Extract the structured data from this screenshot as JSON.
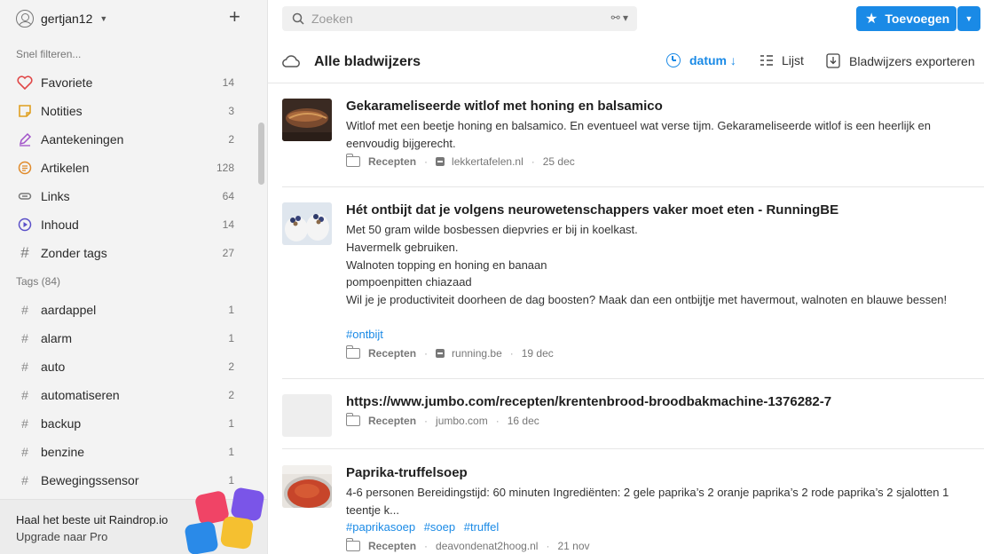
{
  "user": {
    "name": "gertjan12"
  },
  "sidebar": {
    "quick_filter": "Snel filteren...",
    "filters": [
      {
        "label": "Favoriete",
        "count": "14",
        "icon": "heart-icon"
      },
      {
        "label": "Notities",
        "count": "3",
        "icon": "note-icon"
      },
      {
        "label": "Aantekeningen",
        "count": "2",
        "icon": "pencil-icon"
      },
      {
        "label": "Artikelen",
        "count": "128",
        "icon": "article-icon"
      },
      {
        "label": "Links",
        "count": "64",
        "icon": "link-icon"
      },
      {
        "label": "Inhoud",
        "count": "14",
        "icon": "play-icon"
      },
      {
        "label": "Zonder tags",
        "count": "27",
        "icon": "hash-icon"
      }
    ],
    "tags_title": "Tags (84)",
    "tags": [
      {
        "label": "aardappel",
        "count": "1"
      },
      {
        "label": "alarm",
        "count": "1"
      },
      {
        "label": "auto",
        "count": "2"
      },
      {
        "label": "automatiseren",
        "count": "2"
      },
      {
        "label": "backup",
        "count": "1"
      },
      {
        "label": "benzine",
        "count": "1"
      },
      {
        "label": "Bewegingssensor",
        "count": "1"
      }
    ],
    "promo": {
      "title": "Haal het beste uit Raindrop.io",
      "subtitle": "Upgrade naar Pro"
    }
  },
  "header": {
    "search_placeholder": "Zoeken",
    "add_label": "Toevoegen",
    "page_title": "Alle bladwijzers",
    "sort_label": "datum ↓",
    "view_label": "Lijst",
    "export_label": "Bladwijzers exporteren"
  },
  "bookmarks": [
    {
      "title": "Gekarameliseerde witlof met honing en balsamico",
      "desc": [
        "Witlof met een beetje honing en balsamico. En eventueel wat verse tijm. Gekarameliseerde witlof is een heerlijk en eenvoudig bijgerecht."
      ],
      "tags": [],
      "collection": "Recepten",
      "domain": "lekkertafelen.nl",
      "date": "25 dec"
    },
    {
      "title": "Hét ontbijt dat je volgens neurowetenschappers vaker moet eten - RunningBE",
      "desc": [
        "Met 50 gram wilde bosbessen diepvries er bij in koelkast.",
        "Havermelk gebruiken.",
        "Walnoten topping en honing en banaan",
        "pompoenpitten chiazaad",
        "Wil je je productiviteit doorheen de dag boosten? Maak dan een ontbijtje met havermout, walnoten en blauwe bessen!"
      ],
      "tags": [
        "#ontbijt"
      ],
      "collection": "Recepten",
      "domain": "running.be",
      "date": "19 dec"
    },
    {
      "title": "https://www.jumbo.com/recepten/krentenbrood-broodbakmachine-1376282-7",
      "desc": [],
      "tags": [],
      "collection": "Recepten",
      "domain": "jumbo.com",
      "date": "16 dec"
    },
    {
      "title": "Paprika-truffelsoep",
      "desc": [
        "4-6 personen   Bereidingstijd: 60 minuten   Ingrediënten:   2 gele paprika’s  2 oranje paprika’s  2 rode paprika’s  2 sjalotten  1 teentje k..."
      ],
      "tags": [
        "#paprikasoep",
        "#soep",
        "#truffel"
      ],
      "collection": "Recepten",
      "domain": "deavondenat2hoog.nl",
      "date": "21 nov"
    }
  ],
  "colors": {
    "accent": "#1a8ae6",
    "sidebar_bg": "#f3f3f3"
  }
}
